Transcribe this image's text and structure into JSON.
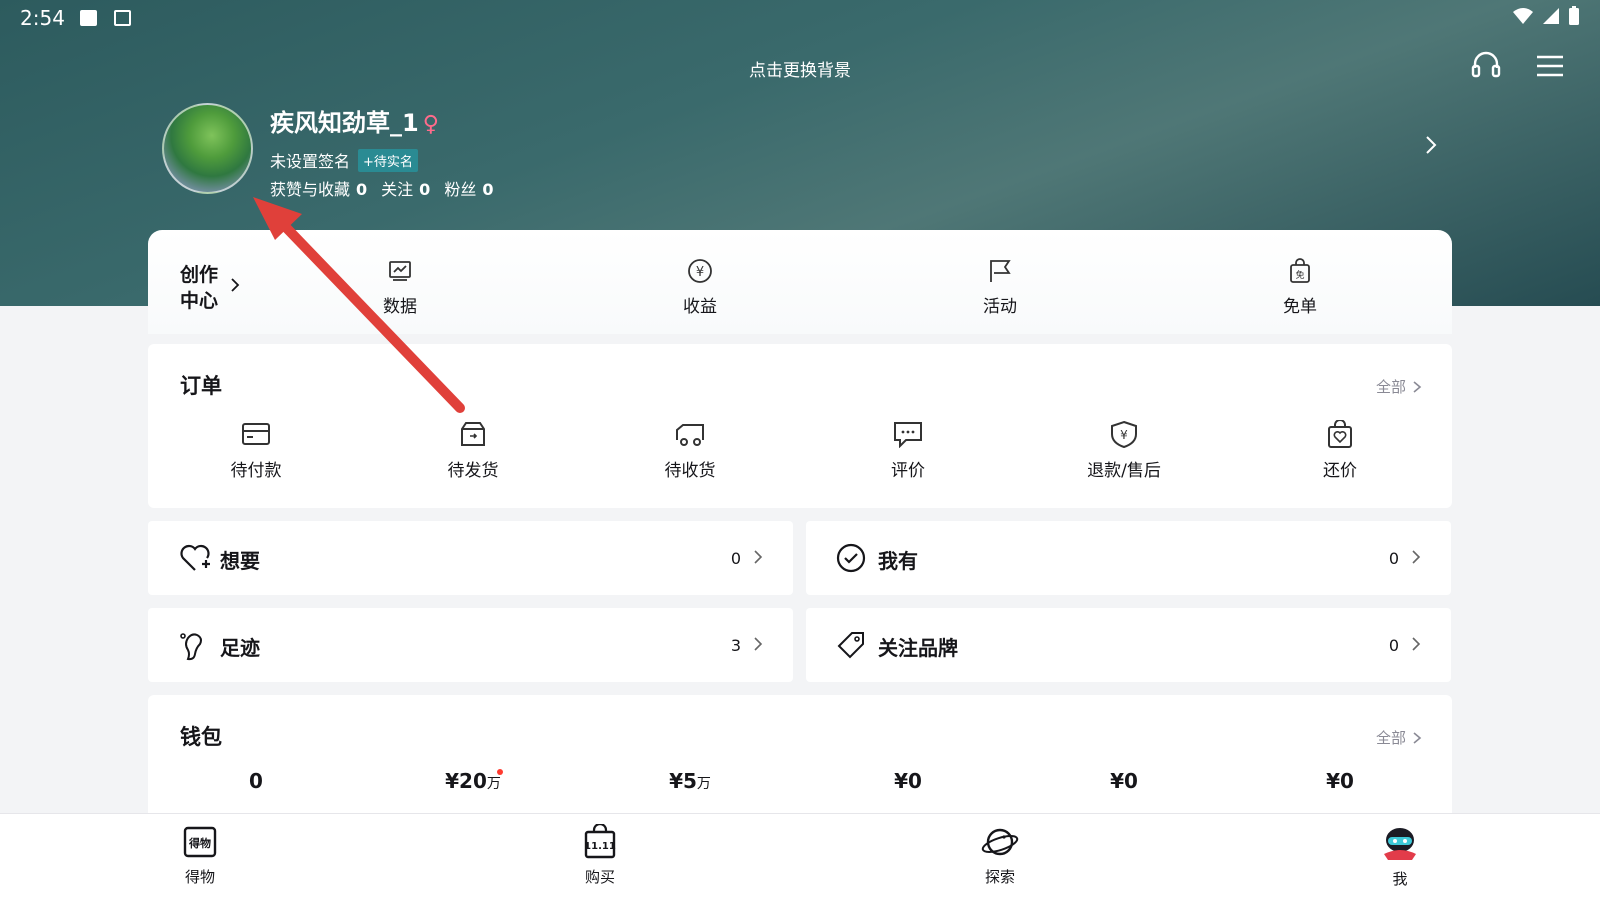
{
  "status_bar": {
    "time": "2:54",
    "icons": [
      "image-icon",
      "a-icon",
      "wifi-icon",
      "signal-icon",
      "battery-icon"
    ]
  },
  "header": {
    "bg_hint": "点击更换背景",
    "icons": [
      "headset-icon",
      "menu-icon"
    ]
  },
  "profile": {
    "username": "疾风知劲草_1",
    "gender_symbol": "♀",
    "signature": "未设置签名",
    "verify_badge": "+待实名",
    "stats": [
      {
        "label": "获赞与收藏",
        "value": "0"
      },
      {
        "label": "关注",
        "value": "0"
      },
      {
        "label": "粉丝",
        "value": "0"
      }
    ]
  },
  "creator": {
    "title": "创作中心",
    "items": [
      {
        "label": "数据",
        "icon": "chart-icon"
      },
      {
        "label": "收益",
        "icon": "yuan-circle-icon"
      },
      {
        "label": "活动",
        "icon": "flag-icon"
      },
      {
        "label": "免单",
        "icon": "free-bag-icon"
      }
    ]
  },
  "orders": {
    "title": "订单",
    "all_label": "全部",
    "items": [
      {
        "label": "待付款",
        "icon": "wallet-icon"
      },
      {
        "label": "待发货",
        "icon": "box-icon"
      },
      {
        "label": "待收货",
        "icon": "truck-icon"
      },
      {
        "label": "评价",
        "icon": "comment-icon"
      },
      {
        "label": "退款/售后",
        "icon": "shield-yuan-icon"
      },
      {
        "label": "还价",
        "icon": "bag-heart-icon"
      }
    ]
  },
  "shortcuts": [
    {
      "label": "想要",
      "count": "0",
      "icon": "heart-plus-icon"
    },
    {
      "label": "我有",
      "count": "0",
      "icon": "check-circle-icon"
    },
    {
      "label": "足迹",
      "count": "3",
      "icon": "footprint-icon"
    },
    {
      "label": "关注品牌",
      "count": "0",
      "icon": "tag-icon"
    }
  ],
  "wallet": {
    "title": "钱包",
    "all_label": "全部",
    "values": [
      {
        "num": "0",
        "unit": ""
      },
      {
        "num": "¥20",
        "unit": "万"
      },
      {
        "num": "¥5",
        "unit": "万"
      },
      {
        "num": "¥0",
        "unit": ""
      },
      {
        "num": "¥0",
        "unit": ""
      },
      {
        "num": "¥0",
        "unit": ""
      }
    ]
  },
  "tabbar": [
    {
      "label": "得物",
      "icon": "dewu-logo-icon"
    },
    {
      "label": "购买",
      "icon": "shopping-bag-1111-icon"
    },
    {
      "label": "探索",
      "icon": "planet-icon"
    },
    {
      "label": "我",
      "icon": "avatar-mascot-icon"
    }
  ],
  "colors": {
    "annotation_arrow": "#e0403a",
    "accent_badge": "#2a8b93"
  }
}
